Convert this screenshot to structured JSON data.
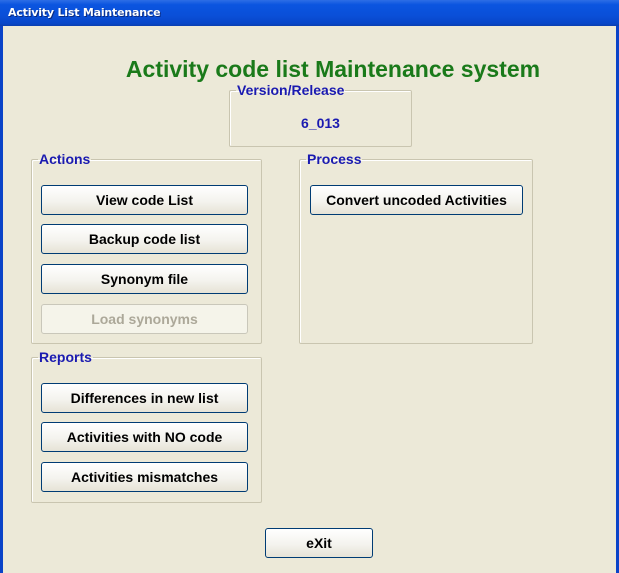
{
  "window": {
    "title": "Activity List Maintenance"
  },
  "header": {
    "title": "Activity code list Maintenance system"
  },
  "version": {
    "label": "Version/Release",
    "value": "6_013"
  },
  "actions": {
    "label": "Actions",
    "view_code_list": "View code List",
    "backup_code_list": "Backup code list",
    "synonym_file": "Synonym file",
    "load_synonyms": "Load synonyms"
  },
  "process": {
    "label": "Process",
    "convert_uncoded": "Convert uncoded Activities"
  },
  "reports": {
    "label": "Reports",
    "differences_new_list": "Differences in new list",
    "activities_no_code": "Activities with NO code",
    "activities_mismatches": "Activities mismatches"
  },
  "footer": {
    "exit": "eXit"
  },
  "colors": {
    "title_green": "#1a7a1a",
    "group_label_blue": "#1a1ab0",
    "window_bg": "#ece9d8",
    "titlebar_blue": "#0a4fd8"
  }
}
